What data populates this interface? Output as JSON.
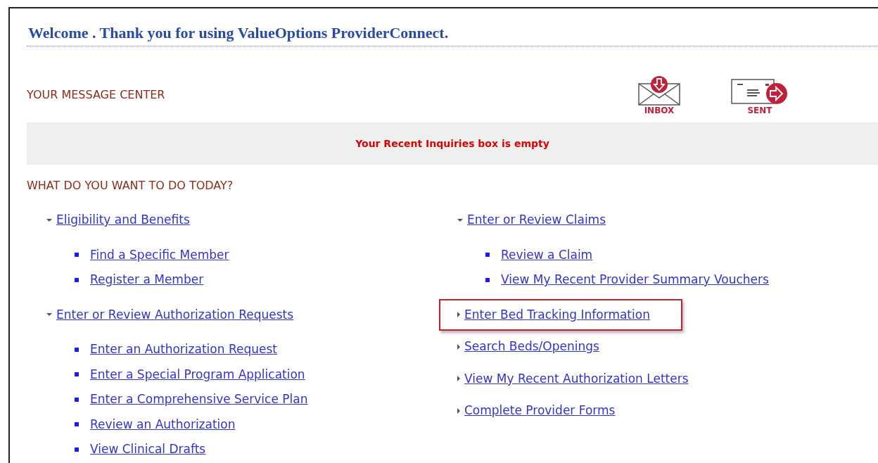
{
  "welcome": "Welcome . Thank you for using ValueOptions ProviderConnect.",
  "message_center": {
    "title": "YOUR MESSAGE CENTER",
    "buttons": [
      {
        "kind": "inbox",
        "label": "INBOX"
      },
      {
        "kind": "sent",
        "label": "SENT"
      }
    ],
    "notice": "Your Recent Inquiries box is empty"
  },
  "tasks": {
    "title": "WHAT DO YOU WANT TO DO TODAY?",
    "columns": [
      {
        "items": [
          {
            "label": "Eligibility and Benefits",
            "expanded": true,
            "highlighted": false,
            "children": [
              "Find a Specific Member",
              "Register a Member"
            ]
          },
          {
            "label": "Enter or Review Authorization Requests",
            "expanded": true,
            "highlighted": false,
            "children": [
              "Enter an Authorization Request",
              "Enter a Special Program Application",
              "Enter a Comprehensive Service Plan",
              "Review an Authorization",
              "View Clinical Drafts"
            ]
          }
        ]
      },
      {
        "items": [
          {
            "label": "Enter or Review Claims",
            "expanded": true,
            "highlighted": false,
            "children": [
              "Review a Claim",
              "View My Recent Provider Summary Vouchers"
            ]
          },
          {
            "label": "Enter Bed Tracking Information",
            "expanded": false,
            "highlighted": true
          },
          {
            "label": "Search Beds/Openings",
            "expanded": false,
            "highlighted": false
          },
          {
            "label": "View My Recent Authorization Letters",
            "expanded": false,
            "highlighted": false
          },
          {
            "label": "Complete Provider Forms",
            "expanded": false,
            "highlighted": false
          }
        ]
      }
    ]
  }
}
